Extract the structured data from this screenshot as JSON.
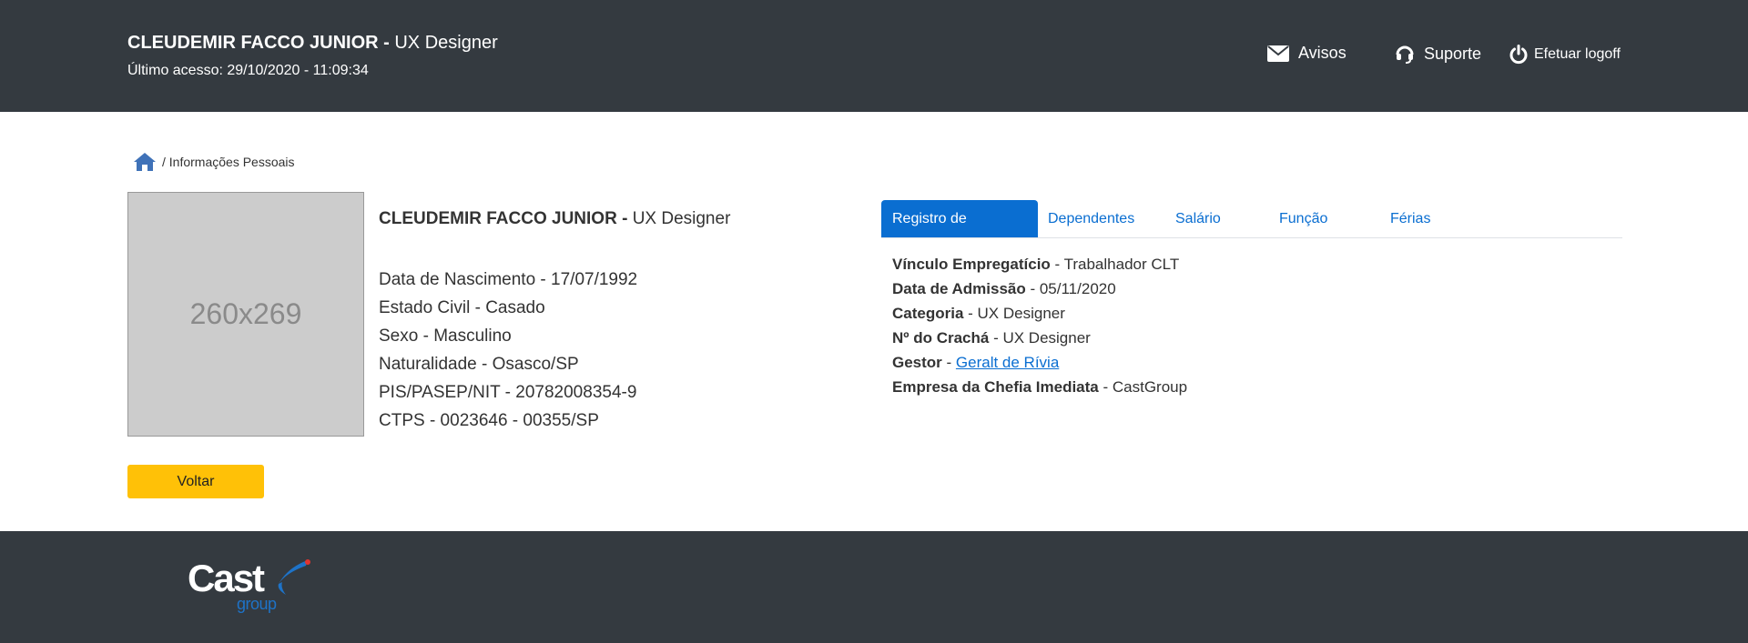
{
  "header": {
    "user_name": "CLEUDEMIR FACCO JUNIOR -",
    "user_role": "UX Designer",
    "last_access": "Último acesso: 29/10/2020 - 11:09:34",
    "nav": {
      "avisos": "Avisos",
      "suporte": "Suporte",
      "logoff": "Efetuar logoff"
    }
  },
  "breadcrumb": {
    "current": "/ Informações Pessoais"
  },
  "photo": {
    "placeholder": "260x269"
  },
  "profile": {
    "name": "CLEUDEMIR FACCO JUNIOR -",
    "role": "UX Designer",
    "lines": [
      "Data de Nascimento - 17/07/1992",
      "Estado Civil - Casado",
      "Sexo - Masculino",
      "Naturalidade - Osasco/SP",
      "PIS/PASEP/NIT - 20782008354-9",
      "CTPS - 0023646 - 00355/SP"
    ]
  },
  "buttons": {
    "voltar": "Voltar"
  },
  "tabs": [
    {
      "label": "Registro de Emprego",
      "active": true
    },
    {
      "label": "Dependentes",
      "active": false
    },
    {
      "label": "Salário",
      "active": false
    },
    {
      "label": "Função",
      "active": false
    },
    {
      "label": "Férias",
      "active": false
    }
  ],
  "employment": [
    {
      "label": "Vínculo Empregatício",
      "value": " - Trabalhador CLT"
    },
    {
      "label": "Data de Admissão",
      "value": " - 05/11/2020"
    },
    {
      "label": "Categoria",
      "value": " - UX Designer"
    },
    {
      "label": "Nº do Crachá",
      "value": " - UX Designer"
    },
    {
      "label": "Gestor",
      "value": " - ",
      "link": "Geralt de Rívia"
    },
    {
      "label": "Empresa da Chefia Imediata",
      "value": " - CastGroup"
    }
  ],
  "footer": {
    "logo_main": "Cast",
    "logo_sub": "group"
  },
  "colors": {
    "header_bg": "#343a40",
    "accent": "#0a6ed1",
    "button_yellow": "#ffc107",
    "photo_bg": "#cccccc"
  },
  "icons": [
    "envelope-icon",
    "headset-icon",
    "power-icon",
    "home-icon"
  ]
}
